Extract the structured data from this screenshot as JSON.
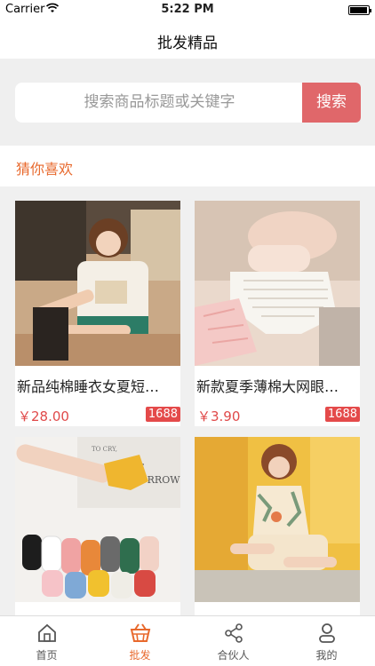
{
  "status_bar": {
    "carrier": "Carrier",
    "time": "5:22 PM"
  },
  "nav": {
    "title": "批发精品"
  },
  "search": {
    "placeholder": "搜索商品标题或关键字",
    "button": "搜索"
  },
  "section": {
    "title": "猜你喜欢"
  },
  "products": [
    {
      "name": "新品纯棉睡衣女夏短…",
      "price": "￥28.00",
      "badge": "1688"
    },
    {
      "name": "新款夏季薄棉大网眼…",
      "price": "￥3.90",
      "badge": "1688"
    },
    {
      "name": "",
      "price": "",
      "badge": ""
    },
    {
      "name": "",
      "price": "",
      "badge": ""
    }
  ],
  "tabs": [
    {
      "label": "首页",
      "icon": "home-icon",
      "active": false
    },
    {
      "label": "批发",
      "icon": "basket-icon",
      "active": true
    },
    {
      "label": "合伙人",
      "icon": "share-icon",
      "active": false
    },
    {
      "label": "我的",
      "icon": "user-icon",
      "active": false
    }
  ],
  "colors": {
    "accent": "#e8692d",
    "search_button": "#e0676a",
    "price": "#e04a4a",
    "badge": "#e44a4a"
  }
}
